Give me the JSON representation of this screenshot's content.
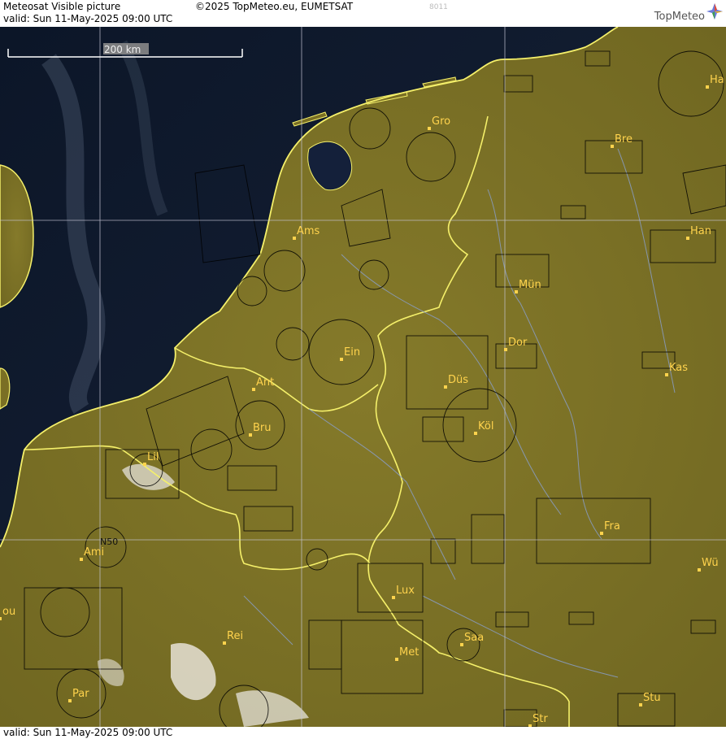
{
  "header": {
    "product_title": "Meteosat Visible picture",
    "copyright": "©2025 TopMeteo.eu, EUMETSAT",
    "valid_line": "valid:  Sun  11-May-2025  09:00 UTC",
    "code": "8011",
    "logo_text": "TopMeteo"
  },
  "scale_bar": {
    "label": "200 km"
  },
  "cities": [
    {
      "name": "Gro"
    },
    {
      "name": "Bre"
    },
    {
      "name": "Ha"
    },
    {
      "name": "Ams"
    },
    {
      "name": "Han"
    },
    {
      "name": "Mün"
    },
    {
      "name": "Ein"
    },
    {
      "name": "Dor"
    },
    {
      "name": "Ant"
    },
    {
      "name": "Düs"
    },
    {
      "name": "Kas"
    },
    {
      "name": "Bru"
    },
    {
      "name": "Köl"
    },
    {
      "name": "Lil"
    },
    {
      "name": "Fra"
    },
    {
      "name": "Ami"
    },
    {
      "name": "Wü"
    },
    {
      "name": "Lux"
    },
    {
      "name": "ou"
    },
    {
      "name": "Rei"
    },
    {
      "name": "Saa"
    },
    {
      "name": "Met"
    },
    {
      "name": "Par"
    },
    {
      "name": "Stu"
    },
    {
      "name": "Str"
    }
  ],
  "grid_label": "N50",
  "footer": {
    "valid_line": "valid:  Sun  11-May-2025  09:00 UTC"
  },
  "colors": {
    "sea": "#0f1a2e",
    "land": "#7a6f24",
    "border": "#f5f06a",
    "grid": "#c8c8d8",
    "city": "#ffd34d"
  }
}
